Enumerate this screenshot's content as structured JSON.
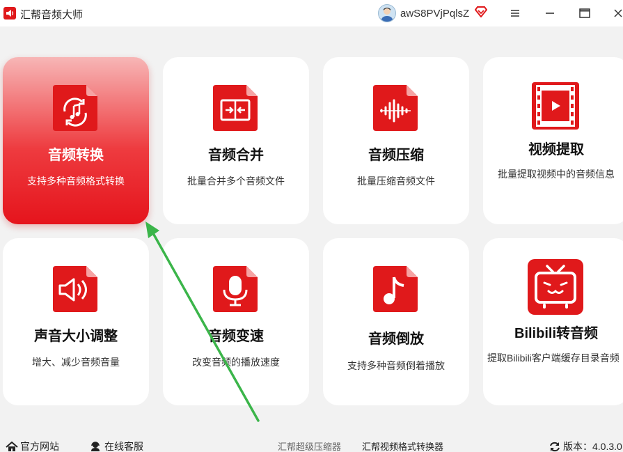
{
  "app": {
    "title": "汇帮音频大师"
  },
  "user": {
    "name": "awS8PVjPqlsZ"
  },
  "cards": [
    {
      "title": "音频转换",
      "desc": "支持多种音频格式转换",
      "icon": "audio-convert-icon"
    },
    {
      "title": "音频合并",
      "desc": "批量合并多个音频文件",
      "icon": "audio-merge-icon"
    },
    {
      "title": "音频压缩",
      "desc": "批量压缩音频文件",
      "icon": "audio-compress-icon"
    },
    {
      "title": "视频提取",
      "desc": "批量提取视频中的音频信息",
      "icon": "video-extract-icon"
    },
    {
      "title": "声音大小调整",
      "desc": "增大、减少音频音量",
      "icon": "volume-icon"
    },
    {
      "title": "音频变速",
      "desc": "改变音频的播放速度",
      "icon": "microphone-icon"
    },
    {
      "title": "音频倒放",
      "desc": "支持多种音频倒着播放",
      "icon": "music-note-icon"
    },
    {
      "title": "Bilibili转音频",
      "desc": "提取Bilibili客户端缓存目录音频",
      "icon": "bilibili-tv-icon"
    }
  ],
  "footer": {
    "website": "官方网站",
    "support": "在线客服",
    "link1": "汇帮超级压缩器",
    "link2": "汇帮视频格式转换器",
    "version": "版本：4.0.3.0"
  },
  "colors": {
    "accent": "#e0191b",
    "arrow": "#3bb54a"
  }
}
